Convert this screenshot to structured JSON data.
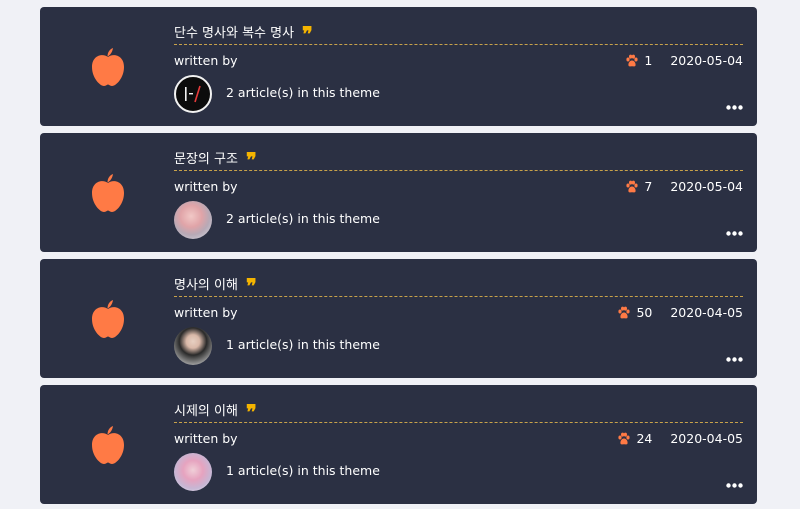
{
  "colors": {
    "card_bg": "#2b3043",
    "page_bg": "#f0f1f6",
    "apple": "#ff7a45",
    "paw": "#ff7a45",
    "quote": "#f4b400",
    "divider": "#c8a24a",
    "text": "#ffffff"
  },
  "icons": {
    "apple": "apple-icon",
    "quote": "quote-icon",
    "paw": "paw-icon",
    "more": "more-icon",
    "quote_glyph": "❞"
  },
  "posts": [
    {
      "title": "단수 명사와 복수 명사",
      "written_by": "written by",
      "views": "1",
      "date": "2020-05-04",
      "articles_text": "2 article(s) in this theme"
    },
    {
      "title": "문장의 구조",
      "written_by": "written by",
      "views": "7",
      "date": "2020-05-04",
      "articles_text": "2 article(s) in this theme"
    },
    {
      "title": "명사의 이해",
      "written_by": "written by",
      "views": "50",
      "date": "2020-04-05",
      "articles_text": "1 article(s) in this theme"
    },
    {
      "title": "시제의 이해",
      "written_by": "written by",
      "views": "24",
      "date": "2020-04-05",
      "articles_text": "1 article(s) in this theme"
    }
  ]
}
